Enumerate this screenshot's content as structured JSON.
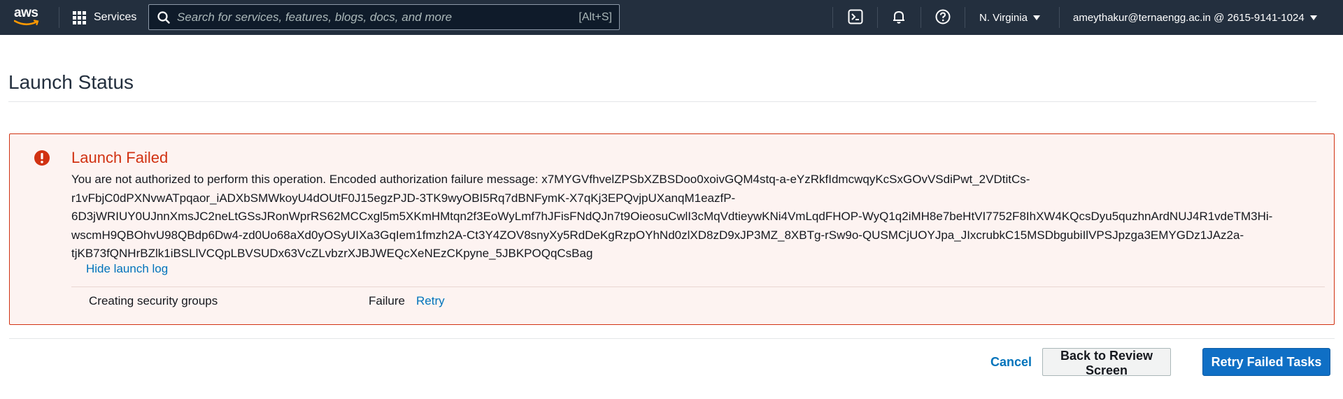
{
  "nav": {
    "logo_text": "aws",
    "services_label": "Services",
    "search_placeholder": "Search for services, features, blogs, docs, and more",
    "search_shortcut": "[Alt+S]",
    "region": "N. Virginia",
    "account": "ameythakur@ternaengg.ac.in @ 2615-9141-1024",
    "colors": {
      "bar": "#232f3e",
      "accent": "#ff9900"
    }
  },
  "page": {
    "title": "Launch Status"
  },
  "alert": {
    "title": "Launch Failed",
    "message_lines": [
      "You are not authorized to perform this operation. Encoded authorization failure message: x7MYGVfhvelZPSbXZBSDoo0xoivGQM4stq-a-eYzRkfIdmcwqyKcSxGOvVSdiPwt_2VDtitCs-",
      "r1vFbjC0dPXNvwATpqaor_iADXbSMWkoyU4dOUtF0J15egzPJD-3TK9wyOBI5Rq7dBNFymK-X7qKj3EPQvjpUXanqM1eazfP-",
      "6D3jWRIUY0UJnnXmsJC2neLtGSsJRonWprRS62MCCxgl5m5XKmHMtqn2f3EoWyLmf7hJFisFNdQJn7t9OieosuCwlI3cMqVdtieywKNi4VmLqdFHOP-WyQ1q2iMH8e7beHtVI7752F8IhXW4KQcsDyu5quzhnArdNUJ4R1vdeTM3Hi-",
      "wscmH9QBOhvU98QBdp6Dw4-zd0Uo68aXd0yOSyUIXa3GqIem1fmzh2A-Ct3Y4ZOV8snyXy5RdDeKgRzpOYhNd0zlXD8zD9xJP3MZ_8XBTg-rSw9o-QUSMCjUOYJpa_JIxcrubkC15MSDbgubiIlVPSJpzga3EMYGDz1JAz2a-",
      "tjKB73fQNHrBZlk1iBSLlVCQpLBVSUDx63VcZLvbzrXJBJWEQcXeNEzCKpyne_5JBKPOQqCsBag"
    ],
    "hide_log_label": "Hide launch log",
    "log": [
      {
        "task": "Creating security groups",
        "status": "Failure",
        "action": "Retry"
      }
    ],
    "colors": {
      "error": "#d13212",
      "background": "#fdf3f1"
    }
  },
  "actions": {
    "cancel_label": "Cancel",
    "back_label": "Back to Review Screen",
    "retry_label": "Retry Failed Tasks",
    "primary_color": "#0f6fc5"
  }
}
